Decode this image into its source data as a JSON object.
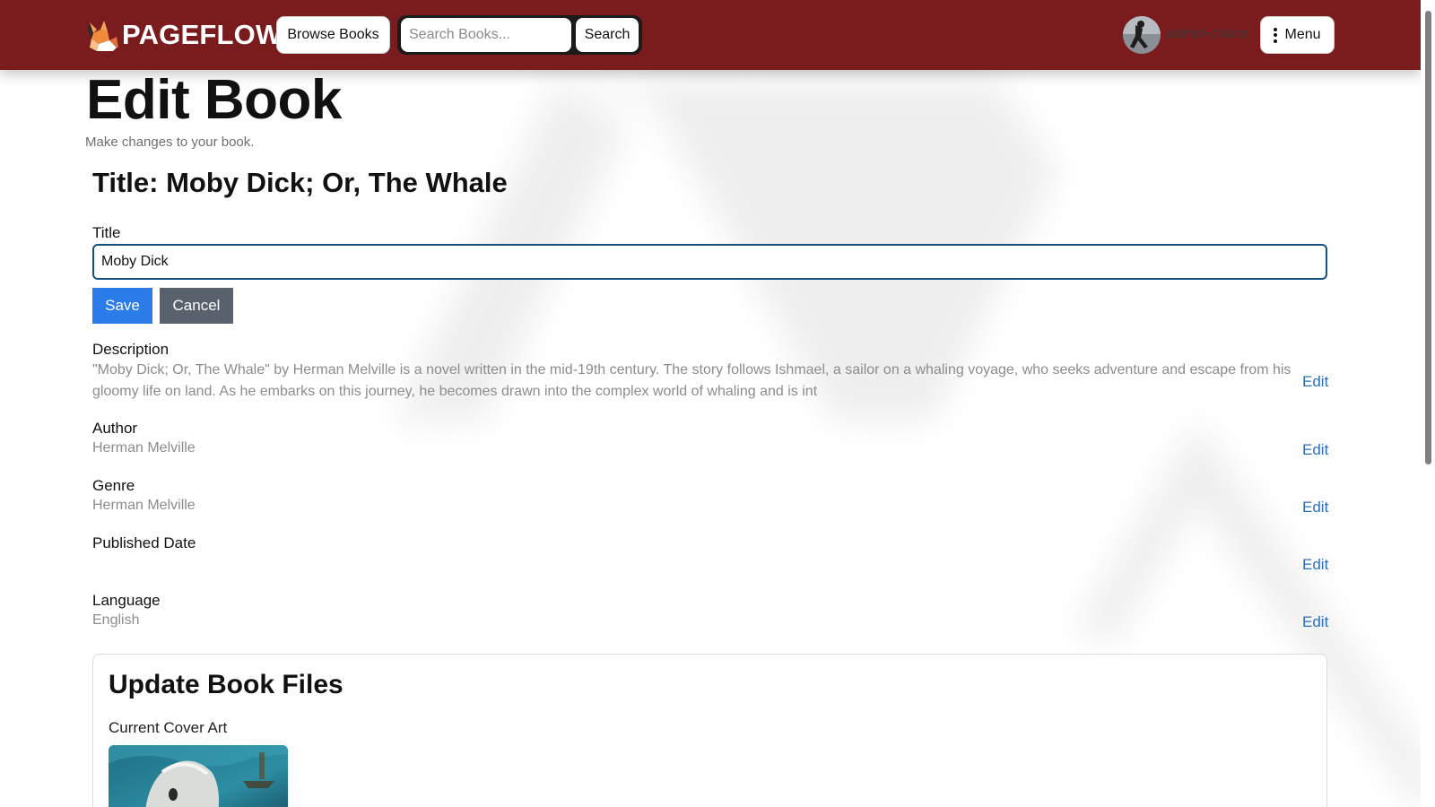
{
  "header": {
    "brand": "PAGEFLOW",
    "browse_label": "Browse Books",
    "search_placeholder": "Search Books...",
    "search_label": "Search",
    "username": "admin-chace",
    "menu_label": "Menu",
    "bar_color": "#7a1c1e"
  },
  "page": {
    "title": "Edit Book",
    "subtitle": "Make changes to your book.",
    "book_heading": "Title: Moby Dick; Or, The Whale"
  },
  "title_field": {
    "label": "Title",
    "value": "Moby Dick",
    "save_label": "Save",
    "cancel_label": "Cancel"
  },
  "fields": {
    "description": {
      "label": "Description",
      "value": "\"Moby Dick; Or, The Whale\" by Herman Melville is a novel written in the mid-19th century. The story follows Ishmael, a sailor on a whaling voyage, who seeks adventure and escape from his gloomy life on land. As he embarks on this journey, he becomes drawn into the complex world of whaling and is int",
      "edit_label": "Edit"
    },
    "author": {
      "label": "Author",
      "value": "Herman Melville",
      "edit_label": "Edit"
    },
    "genre": {
      "label": "Genre",
      "value": "Herman Melville",
      "edit_label": "Edit"
    },
    "published_date": {
      "label": "Published Date",
      "value": "",
      "edit_label": "Edit"
    },
    "language": {
      "label": "Language",
      "value": "English",
      "edit_label": "Edit"
    }
  },
  "files": {
    "title": "Update Book Files",
    "cover_label": "Current Cover Art"
  },
  "colors": {
    "accent": "#2b7be8",
    "secondary": "#59616c",
    "link": "#2a6fb8"
  }
}
